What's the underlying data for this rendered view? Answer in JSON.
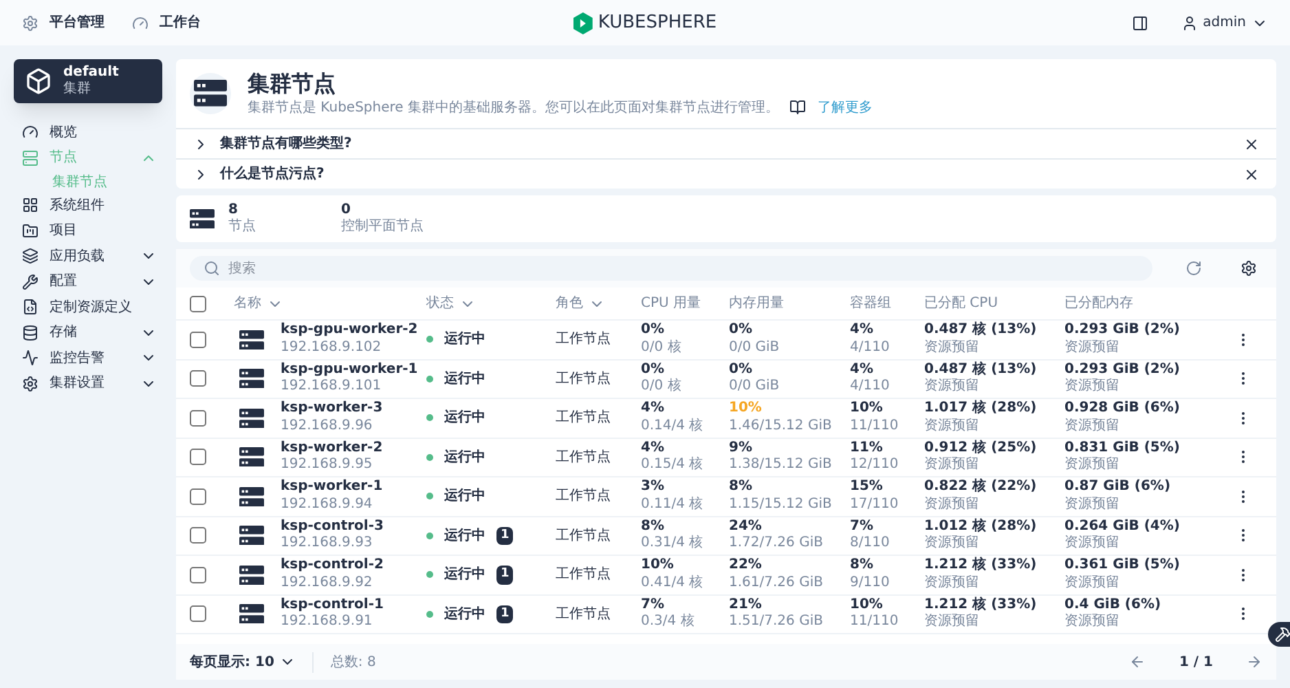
{
  "top_bar": {
    "nav": [
      {
        "label": "平台管理"
      },
      {
        "label": "工作台"
      }
    ],
    "logo": "KUBESPHERE",
    "user": "admin"
  },
  "cluster": {
    "name": "default",
    "type": "集群"
  },
  "sidebar": {
    "items": [
      {
        "label": "概览",
        "selected": false
      },
      {
        "label": "节点",
        "selected": true,
        "expanded": true,
        "children": [
          {
            "label": "集群节点",
            "selected": true
          }
        ]
      },
      {
        "label": "系统组件",
        "selected": false
      },
      {
        "label": "项目",
        "selected": false
      },
      {
        "label": "应用负载",
        "selected": false,
        "expanded": false
      },
      {
        "label": "配置",
        "selected": false,
        "expanded": false
      },
      {
        "label": "定制资源定义",
        "selected": false
      },
      {
        "label": "存储",
        "selected": false,
        "expanded": false
      },
      {
        "label": "监控告警",
        "selected": false,
        "expanded": false
      },
      {
        "label": "集群设置",
        "selected": false,
        "expanded": false
      }
    ]
  },
  "header": {
    "title": "集群节点",
    "description": "集群节点是 KubeSphere 集群中的基础服务器。您可以在此页面对集群节点进行管理。",
    "learn_more": "了解更多"
  },
  "faq": [
    {
      "question": "集群节点有哪些类型?",
      "expanded": false
    },
    {
      "question": "什么是节点污点?",
      "expanded": false
    }
  ],
  "stats": [
    {
      "value": "8",
      "label": "节点"
    },
    {
      "value": "0",
      "label": "控制平面节点"
    }
  ],
  "search": {
    "placeholder": "搜索"
  },
  "table": {
    "all_checked": false,
    "columns": [
      {
        "label": "名称",
        "sortable": true
      },
      {
        "label": "状态",
        "sortable": true
      },
      {
        "label": "角色",
        "sortable": true
      },
      {
        "label": "CPU 用量",
        "sortable": false
      },
      {
        "label": "内存用量",
        "sortable": false
      },
      {
        "label": "容器组",
        "sortable": false
      },
      {
        "label": "已分配 CPU",
        "sortable": false
      },
      {
        "label": "已分配内存",
        "sortable": false
      }
    ],
    "rows": [
      {
        "checked": false,
        "name": "ksp-gpu-worker-2",
        "ip": "192.168.9.102",
        "status": "运行中",
        "color": "#55bc8a",
        "taint": "",
        "role": "工作节点",
        "cpu": "0%",
        "cpu_detail": "0/0 核",
        "mem": "0%",
        "mem_warning": false,
        "mem_detail": "0/0 GiB",
        "pods": "4%",
        "pods_detail": "4/110",
        "alloc_cpu": "0.487 核 (13%)",
        "alloc_cpu_note": "资源预留",
        "alloc_mem": "0.293 GiB (2%)",
        "alloc_mem_note": "资源预留"
      },
      {
        "checked": false,
        "name": "ksp-gpu-worker-1",
        "ip": "192.168.9.101",
        "status": "运行中",
        "color": "#55bc8a",
        "taint": "",
        "role": "工作节点",
        "cpu": "0%",
        "cpu_detail": "0/0 核",
        "mem": "0%",
        "mem_warning": false,
        "mem_detail": "0/0 GiB",
        "pods": "4%",
        "pods_detail": "4/110",
        "alloc_cpu": "0.487 核 (13%)",
        "alloc_cpu_note": "资源预留",
        "alloc_mem": "0.293 GiB (2%)",
        "alloc_mem_note": "资源预留"
      },
      {
        "checked": false,
        "name": "ksp-worker-3",
        "ip": "192.168.9.96",
        "status": "运行中",
        "color": "#55bc8a",
        "taint": "",
        "role": "工作节点",
        "cpu": "4%",
        "cpu_detail": "0.14/4 核",
        "mem": "10%",
        "mem_warning": true,
        "mem_detail": "1.46/15.12 GiB",
        "pods": "10%",
        "pods_detail": "11/110",
        "alloc_cpu": "1.017 核 (28%)",
        "alloc_cpu_note": "资源预留",
        "alloc_mem": "0.928 GiB (6%)",
        "alloc_mem_note": "资源预留"
      },
      {
        "checked": false,
        "name": "ksp-worker-2",
        "ip": "192.168.9.95",
        "status": "运行中",
        "color": "#55bc8a",
        "taint": "",
        "role": "工作节点",
        "cpu": "4%",
        "cpu_detail": "0.15/4 核",
        "mem": "9%",
        "mem_warning": false,
        "mem_detail": "1.38/15.12 GiB",
        "pods": "11%",
        "pods_detail": "12/110",
        "alloc_cpu": "0.912 核 (25%)",
        "alloc_cpu_note": "资源预留",
        "alloc_mem": "0.831 GiB (5%)",
        "alloc_mem_note": "资源预留"
      },
      {
        "checked": false,
        "name": "ksp-worker-1",
        "ip": "192.168.9.94",
        "status": "运行中",
        "color": "#55bc8a",
        "taint": "",
        "role": "工作节点",
        "cpu": "3%",
        "cpu_detail": "0.11/4 核",
        "mem": "8%",
        "mem_warning": false,
        "mem_detail": "1.15/15.12 GiB",
        "pods": "15%",
        "pods_detail": "17/110",
        "alloc_cpu": "0.822 核 (22%)",
        "alloc_cpu_note": "资源预留",
        "alloc_mem": "0.87 GiB (6%)",
        "alloc_mem_note": "资源预留"
      },
      {
        "checked": false,
        "name": "ksp-control-3",
        "ip": "192.168.9.93",
        "status": "运行中",
        "color": "#55bc8a",
        "taint": "1",
        "role": "工作节点",
        "cpu": "8%",
        "cpu_detail": "0.31/4 核",
        "mem": "24%",
        "mem_warning": false,
        "mem_detail": "1.72/7.26 GiB",
        "pods": "7%",
        "pods_detail": "8/110",
        "alloc_cpu": "1.012 核 (28%)",
        "alloc_cpu_note": "资源预留",
        "alloc_mem": "0.264 GiB (4%)",
        "alloc_mem_note": "资源预留"
      },
      {
        "checked": false,
        "name": "ksp-control-2",
        "ip": "192.168.9.92",
        "status": "运行中",
        "color": "#55bc8a",
        "taint": "1",
        "role": "工作节点",
        "cpu": "10%",
        "cpu_detail": "0.41/4 核",
        "mem": "22%",
        "mem_warning": false,
        "mem_detail": "1.61/7.26 GiB",
        "pods": "8%",
        "pods_detail": "9/110",
        "alloc_cpu": "1.212 核 (33%)",
        "alloc_cpu_note": "资源预留",
        "alloc_mem": "0.361 GiB (5%)",
        "alloc_mem_note": "资源预留"
      },
      {
        "checked": false,
        "name": "ksp-control-1",
        "ip": "192.168.9.91",
        "status": "运行中",
        "color": "#55bc8a",
        "taint": "1",
        "role": "工作节点",
        "cpu": "7%",
        "cpu_detail": "0.3/4 核",
        "mem": "21%",
        "mem_warning": false,
        "mem_detail": "1.51/7.26 GiB",
        "pods": "10%",
        "pods_detail": "11/110",
        "alloc_cpu": "1.212 核 (33%)",
        "alloc_cpu_note": "资源预留",
        "alloc_mem": "0.4 GiB (6%)",
        "alloc_mem_note": "资源预留"
      }
    ]
  },
  "footer": {
    "page_size_label": "每页显示:",
    "page_size": "10",
    "total": "总数: 8",
    "page": "1 / 1"
  }
}
